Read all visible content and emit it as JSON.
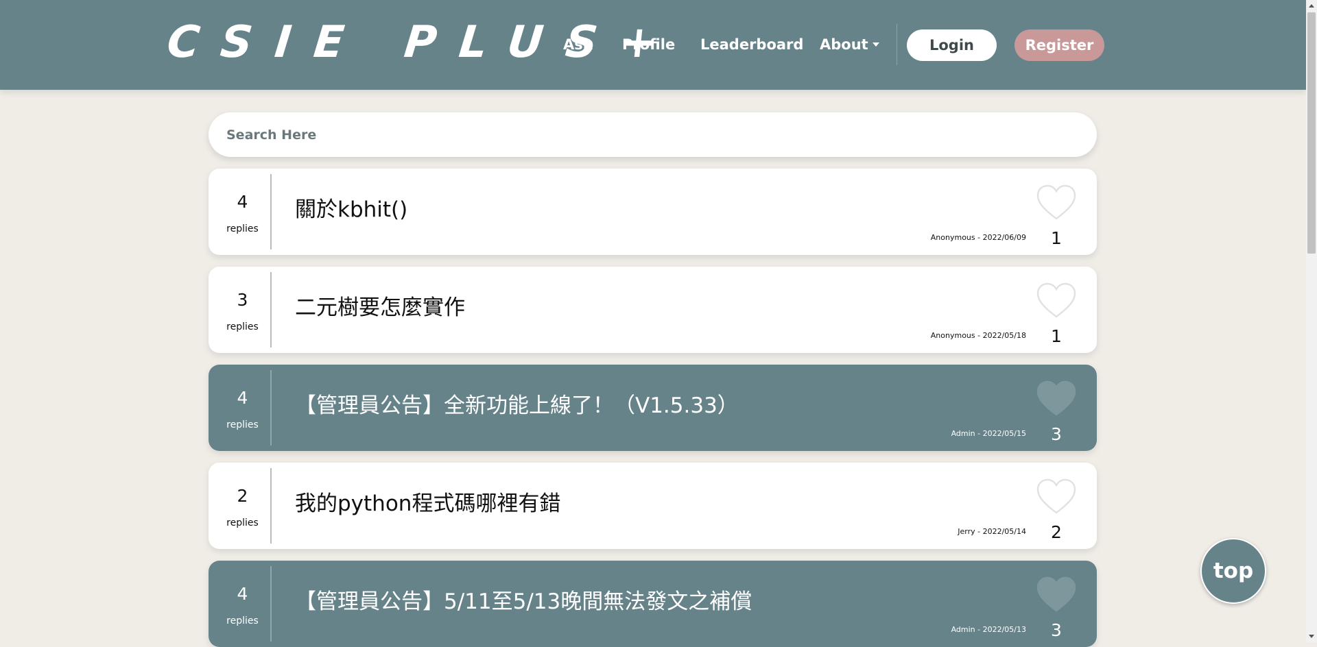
{
  "navbar": {
    "logo": "CSIE PLUS+",
    "links": [
      "Ask",
      "Profile",
      "Leaderboard",
      "About"
    ],
    "login_label": "Login",
    "register_label": "Register"
  },
  "search": {
    "placeholder": "Search Here"
  },
  "replies_label": "replies",
  "posts": [
    {
      "replies": "4",
      "title": "關於kbhit()",
      "meta": "Anonymous - 2022/06/09",
      "likes": "1",
      "admin": false
    },
    {
      "replies": "3",
      "title": "二元樹要怎麼實作",
      "meta": "Anonymous - 2022/05/18",
      "likes": "1",
      "admin": false
    },
    {
      "replies": "4",
      "title": "【管理員公告】全新功能上線了！（V1.5.33）",
      "meta": "Admin - 2022/05/15",
      "likes": "3",
      "admin": true
    },
    {
      "replies": "2",
      "title": "我的python程式碼哪裡有錯",
      "meta": "Jerry - 2022/05/14",
      "likes": "2",
      "admin": false
    },
    {
      "replies": "4",
      "title": "【管理員公告】5/11至5/13晚間無法發文之補償",
      "meta": "Admin - 2022/05/13",
      "likes": "3",
      "admin": true
    }
  ],
  "top_button_label": "top",
  "colors": {
    "primary": "#67838a",
    "background": "#f0ede7",
    "register": "#c99898"
  },
  "icons": [
    "heart-icon",
    "caret-down-icon"
  ]
}
